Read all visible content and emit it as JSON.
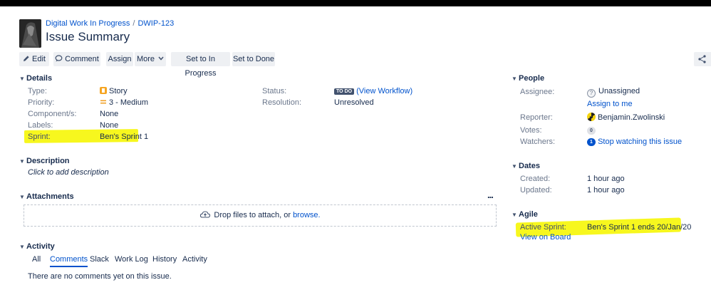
{
  "breadcrumb": {
    "project": "Digital Work In Progress",
    "separator": "/",
    "issue_key": "DWIP-123"
  },
  "issue": {
    "title": "Issue Summary"
  },
  "toolbar": {
    "edit": "Edit",
    "comment": "Comment",
    "assign": "Assign",
    "more": "More",
    "in_progress": "Set to In Progress",
    "done": "Set to Done"
  },
  "details": {
    "heading": "Details",
    "type_label": "Type:",
    "type_value": "Story",
    "priority_label": "Priority:",
    "priority_value": "3 - Medium",
    "components_label": "Component/s:",
    "components_value": "None",
    "labels_label": "Labels:",
    "labels_value": "None",
    "sprint_label": "Sprint:",
    "sprint_value": "Ben's Sprint 1",
    "status_label": "Status:",
    "status_badge": "TO DO",
    "status_link": "(View Workflow)",
    "resolution_label": "Resolution:",
    "resolution_value": "Unresolved"
  },
  "description": {
    "heading": "Description",
    "placeholder": "Click to add description"
  },
  "attachments": {
    "heading": "Attachments",
    "menu": "...",
    "drop_text": "Drop files to attach, or",
    "browse": "browse."
  },
  "activity": {
    "heading": "Activity",
    "tabs": [
      "All",
      "Comments",
      "Slack",
      "Work Log",
      "History",
      "Activity"
    ],
    "active_tab": "Comments",
    "empty_text": "There are no comments yet on this issue."
  },
  "people": {
    "heading": "People",
    "assignee_label": "Assignee:",
    "assignee_value": "Unassigned",
    "assign_to_me": "Assign to me",
    "reporter_label": "Reporter:",
    "reporter_value": "Benjamin.Zwolinski",
    "votes_label": "Votes:",
    "votes_count": "0",
    "watchers_label": "Watchers:",
    "watchers_count": "1",
    "watch_link": "Stop watching this issue"
  },
  "dates": {
    "heading": "Dates",
    "created_label": "Created:",
    "created_value": "1 hour ago",
    "updated_label": "Updated:",
    "updated_value": "1 hour ago"
  },
  "agile": {
    "heading": "Agile",
    "active_sprint_label": "Active Sprint:",
    "active_sprint_value": "Ben's Sprint 1 ends 20/Jan/20",
    "view_on_board": "View on Board"
  },
  "colors": {
    "link": "#0052cc",
    "highlight": "#f7f71e",
    "story": "#f6a522",
    "priority": "#f0a22a",
    "todo_badge": "#42526e"
  },
  "icons": [
    "pencil-icon",
    "comment-icon",
    "chevron-down-icon",
    "story-icon",
    "priority-medium-icon",
    "cloud-upload-icon",
    "more-icon",
    "unassigned-avatar-icon",
    "reporter-avatar-icon",
    "share-icon"
  ]
}
